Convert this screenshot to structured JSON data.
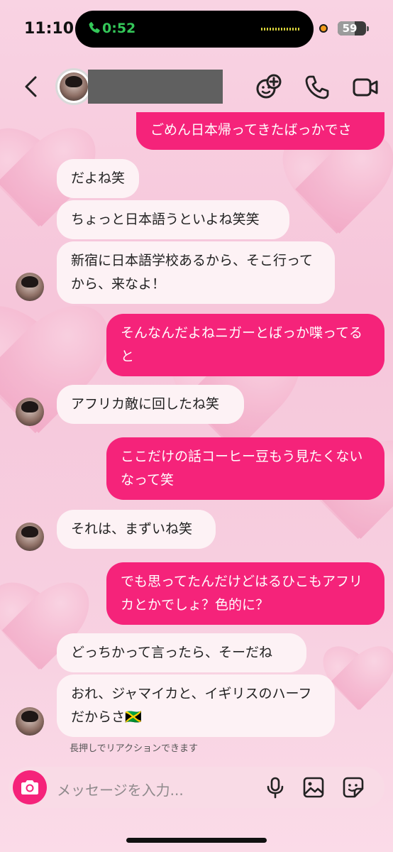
{
  "status_bar": {
    "time": "11:10",
    "call_timer": "0:52",
    "battery_level": "59",
    "battery_fraction": 0.59
  },
  "header": {
    "contact_name_redacted": true
  },
  "messages": [
    {
      "direction": "out",
      "text": "ごめん日本帰ってきたばっかでさ"
    },
    {
      "direction": "in",
      "text": "だよね笑"
    },
    {
      "direction": "in",
      "text": "ちょっと日本語うといよね笑笑"
    },
    {
      "direction": "in",
      "text": "新宿に日本語学校あるから、そこ行ってから、来なよ！"
    },
    {
      "direction": "out",
      "text": "そんなんだよねニガーとばっか喋ってると"
    },
    {
      "direction": "in",
      "text": "アフリカ敵に回したね笑"
    },
    {
      "direction": "out",
      "text": "ここだけの話コーヒー豆もう見たくないなって笑"
    },
    {
      "direction": "in",
      "text": "それは、まずいね笑"
    },
    {
      "direction": "out",
      "text": "でも思ってたんだけどはるひこもアフリカとかでしょ？色的に？"
    },
    {
      "direction": "in",
      "text": "どっちかって言ったら、そーだね"
    },
    {
      "direction": "in",
      "text": "おれ、ジャマイカと、イギリスのハーフだからさ🇯🇲"
    }
  ],
  "reaction_hint": "長押しでリアクションできます",
  "composer": {
    "placeholder": "メッセージを入力..."
  },
  "colors": {
    "outgoing_bubble": "#f5237a",
    "incoming_bubble": "#fdf2f5",
    "call_green": "#34c759"
  },
  "icons": [
    "back-icon",
    "add-friend-effect-icon",
    "phone-icon",
    "video-icon",
    "camera-icon",
    "microphone-icon",
    "gallery-icon",
    "sticker-icon"
  ]
}
